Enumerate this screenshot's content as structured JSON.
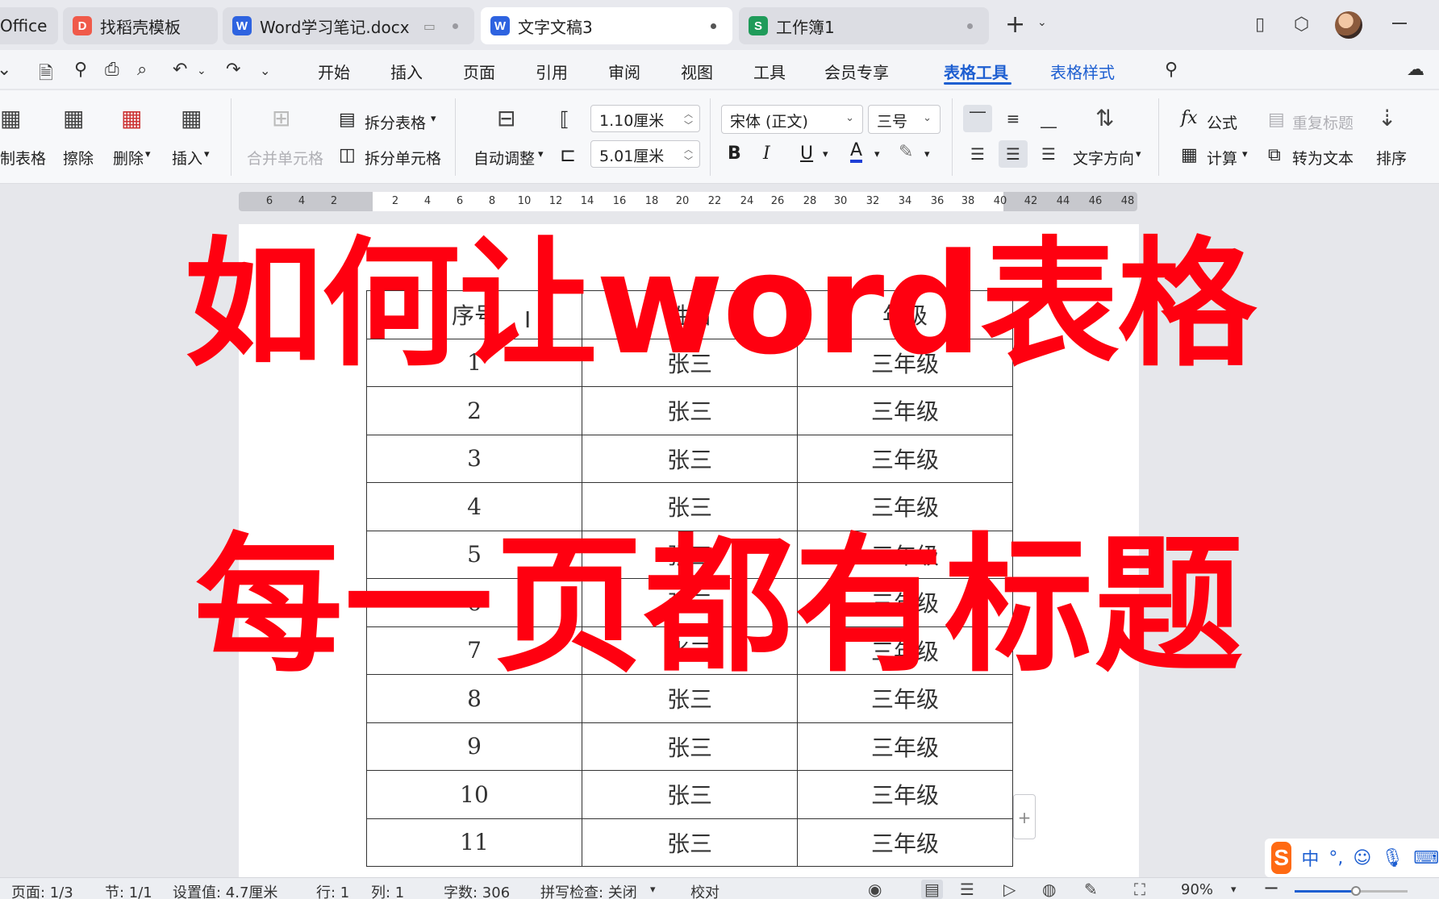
{
  "tabs": [
    {
      "label": "Office",
      "badge": "",
      "active": false
    },
    {
      "label": "找稻壳模板",
      "badge": "D",
      "badge_color": "#f05a4a",
      "active": false
    },
    {
      "label": "Word学习笔记.docx",
      "badge": "W",
      "badge_color": "#2e63e0",
      "active": false
    },
    {
      "label": "文字文稿3",
      "badge": "W",
      "badge_color": "#2e63e0",
      "active": true
    },
    {
      "label": "工作簿1",
      "badge": "S",
      "badge_color": "#1f9b5a",
      "active": false
    }
  ],
  "menu": {
    "items": [
      "开始",
      "插入",
      "页面",
      "引用",
      "审阅",
      "视图",
      "工具",
      "会员专享",
      "表格工具",
      "表格样式"
    ],
    "active": "表格工具"
  },
  "ribbon": {
    "draw_table": "制表格",
    "erase": "擦除",
    "delete": "删除",
    "insert": "插入",
    "merge_cells": "合并单元格",
    "split_table": "拆分表格",
    "split_cells": "拆分单元格",
    "auto_fit": "自动调整",
    "width_value": "1.10厘米",
    "height_value": "5.01厘米",
    "font_name": "宋体 (正文)",
    "font_size": "三号",
    "text_direction": "文字方向",
    "formula": "公式",
    "calculate": "计算",
    "repeat_header": "重复标题",
    "to_text": "转为文本",
    "sort": "排序"
  },
  "ruler": {
    "ticks": [
      "6",
      "4",
      "2",
      "2",
      "4",
      "6",
      "8",
      "10",
      "12",
      "14",
      "16",
      "18",
      "20",
      "22",
      "24",
      "26",
      "28",
      "30",
      "32",
      "34",
      "36",
      "38",
      "40",
      "42",
      "44",
      "46",
      "48"
    ]
  },
  "table": {
    "header": [
      "序号",
      "姓名",
      "年级"
    ],
    "rows": [
      [
        "1",
        "张三",
        "三年级"
      ],
      [
        "2",
        "张三",
        "三年级"
      ],
      [
        "3",
        "张三",
        "三年级"
      ],
      [
        "4",
        "张三",
        "三年级"
      ],
      [
        "5",
        "张三",
        "三年级"
      ],
      [
        "6",
        "张三",
        "三年级"
      ],
      [
        "7",
        "张三",
        "三年级"
      ],
      [
        "8",
        "张三",
        "三年级"
      ],
      [
        "9",
        "张三",
        "三年级"
      ],
      [
        "10",
        "张三",
        "三年级"
      ],
      [
        "11",
        "张三",
        "三年级"
      ]
    ]
  },
  "overlay": {
    "line1": "如何让word表格",
    "line2": "每一页都有标题",
    "color": "#ff0010"
  },
  "ime": {
    "logo": "S",
    "mode": "中",
    "punct": "°,"
  },
  "status": {
    "page": "页面: 1/3",
    "section": "节: 1/1",
    "setting": "设置值: 4.7厘米",
    "row": "行: 1",
    "col": "列: 1",
    "words": "字数: 306",
    "spell": "拼写检查: 关闭",
    "proof": "校对",
    "zoom": "90%"
  }
}
